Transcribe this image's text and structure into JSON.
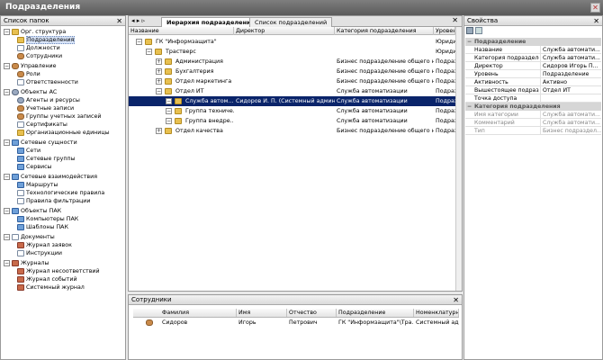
{
  "window": {
    "title": "Подразделения",
    "close_label": "✕"
  },
  "left": {
    "header": "Список папок",
    "tree": [
      {
        "label": "Орг. структура",
        "level": 0,
        "exp": "−",
        "icon": "org-structure-icon",
        "cls": "fold"
      },
      {
        "label": "Подразделения",
        "level": 1,
        "icon": "department-icon",
        "cls": "fold",
        "selected": true
      },
      {
        "label": "Должности",
        "level": 1,
        "icon": "position-icon",
        "cls": "doc"
      },
      {
        "label": "Сотрудники",
        "level": 1,
        "icon": "employee-icon",
        "cls": "person"
      },
      {
        "label": "Управление",
        "level": 0,
        "exp": "−",
        "icon": "management-icon",
        "cls": "person"
      },
      {
        "label": "Роли",
        "level": 1,
        "icon": "roles-icon",
        "cls": "person"
      },
      {
        "label": "Ответственности",
        "level": 1,
        "icon": "responsibility-icon",
        "cls": "doc"
      },
      {
        "label": "Объекты АС",
        "level": 0,
        "exp": "−",
        "icon": "as-objects-icon",
        "cls": "gear"
      },
      {
        "label": "Агенты и ресурсы",
        "level": 1,
        "icon": "agents-icon",
        "cls": "gear"
      },
      {
        "label": "Учетные записи",
        "level": 1,
        "icon": "accounts-icon",
        "cls": "person"
      },
      {
        "label": "Группы учетных записей",
        "level": 1,
        "icon": "account-groups-icon",
        "cls": "person"
      },
      {
        "label": "Сертификаты",
        "level": 1,
        "icon": "certificates-icon",
        "cls": "doc"
      },
      {
        "label": "Организационные единицы",
        "level": 1,
        "icon": "org-units-icon",
        "cls": "fold"
      },
      {
        "label": "Сетевые сущности",
        "level": 0,
        "exp": "−",
        "icon": "network-entities-icon",
        "cls": "net"
      },
      {
        "label": "Сети",
        "level": 1,
        "icon": "networks-icon",
        "cls": "net"
      },
      {
        "label": "Сетевые группы",
        "level": 1,
        "icon": "network-groups-icon",
        "cls": "net"
      },
      {
        "label": "Сервисы",
        "level": 1,
        "icon": "services-icon",
        "cls": "net"
      },
      {
        "label": "Сетевые взаимодействия",
        "level": 0,
        "exp": "−",
        "icon": "network-interactions-icon",
        "cls": "net"
      },
      {
        "label": "Маршруты",
        "level": 1,
        "icon": "routes-icon",
        "cls": "net"
      },
      {
        "label": "Технологические правила",
        "level": 1,
        "icon": "tech-rules-icon",
        "cls": "doc"
      },
      {
        "label": "Правила фильтрации",
        "level": 1,
        "icon": "filter-rules-icon",
        "cls": "doc"
      },
      {
        "label": "Объекты ПАК",
        "level": 0,
        "exp": "−",
        "icon": "pak-objects-icon",
        "cls": "net"
      },
      {
        "label": "Компьютеры ПАК",
        "level": 1,
        "icon": "pak-computers-icon",
        "cls": "net"
      },
      {
        "label": "Шаблоны ПАК",
        "level": 1,
        "icon": "pak-templates-icon",
        "cls": "net"
      },
      {
        "label": "Документы",
        "level": 0,
        "exp": "−",
        "icon": "documents-icon",
        "cls": "doc"
      },
      {
        "label": "Журнал заявок",
        "level": 1,
        "icon": "requests-journal-icon",
        "cls": "book"
      },
      {
        "label": "Инструкции",
        "level": 1,
        "icon": "instructions-icon",
        "cls": "doc"
      },
      {
        "label": "Журналы",
        "level": 0,
        "exp": "−",
        "icon": "journals-icon",
        "cls": "book"
      },
      {
        "label": "Журнал несоответствий",
        "level": 1,
        "icon": "mismatch-journal-icon",
        "cls": "book"
      },
      {
        "label": "Журнал событий",
        "level": 1,
        "icon": "events-journal-icon",
        "cls": "book"
      },
      {
        "label": "Системный журнал",
        "level": 1,
        "icon": "system-journal-icon",
        "cls": "book"
      }
    ]
  },
  "center": {
    "tabs": [
      "Иерархия подразделений",
      "Список подразделений"
    ],
    "columns": [
      "Название",
      "Директор",
      "Категория подразделения",
      "Уровень"
    ],
    "rows": [
      {
        "name": "ГК \"Информзащита\"",
        "director": "",
        "category": "",
        "level": "Юридиче",
        "indent": 0,
        "exp": "−"
      },
      {
        "name": "Трастверс",
        "director": "",
        "category": "",
        "level": "Юридиче",
        "indent": 1,
        "exp": "−"
      },
      {
        "name": "Администрация",
        "director": "",
        "category": "Бизнес подразделение общего наз...",
        "level": "Подразде",
        "indent": 2,
        "exp": "+"
      },
      {
        "name": "Бухгалтерия",
        "director": "",
        "category": "Бизнес подразделение общего наз...",
        "level": "Подразде",
        "indent": 2,
        "exp": "+"
      },
      {
        "name": "Отдел маркетинга",
        "director": "",
        "category": "Бизнес подразделение общего наз...",
        "level": "Подразде",
        "indent": 2,
        "exp": "+"
      },
      {
        "name": "Отдел ИТ",
        "director": "",
        "category": "Служба автоматизации",
        "level": "Подразде",
        "indent": 2,
        "exp": "−"
      },
      {
        "name": "Служба автом...",
        "director": "Сидоров И. П. (Системный админис...",
        "category": "Служба автоматизации",
        "level": "Подразде",
        "indent": 3,
        "exp": "−",
        "selected": true
      },
      {
        "name": "Группа техниче...",
        "director": "",
        "category": "Служба автоматизации",
        "level": "Подразде",
        "indent": 3,
        "exp": "−"
      },
      {
        "name": "Группа внедре...",
        "director": "",
        "category": "Служба автоматизации",
        "level": "Подразде",
        "indent": 3,
        "exp": "−"
      },
      {
        "name": "Отдел качества",
        "director": "",
        "category": "Бизнес подразделение общего наз...",
        "level": "Подразде",
        "indent": 2,
        "exp": "+"
      }
    ]
  },
  "employees": {
    "header": "Сотрудники",
    "columns": [
      "Фамилия",
      "Имя",
      "Отчество",
      "Подразделение",
      "Номенклатурн..."
    ],
    "rows": [
      {
        "last": "Сидоров",
        "first": "Игорь",
        "middle": "Петрович",
        "dept": "ГК \"Информзащита\"\\Тра...",
        "nomen": "Системный админ..."
      }
    ]
  },
  "properties": {
    "header": "Свойства",
    "cat1": "Подразделение",
    "rows1": [
      {
        "name": "Название",
        "value": "Служба автомати..."
      },
      {
        "name": "Категория подразделения",
        "value": "Служба автомати..."
      },
      {
        "name": "Директор",
        "value": "Сидоров Игорь П..."
      },
      {
        "name": "Уровень",
        "value": "Подразделение"
      },
      {
        "name": "Активность",
        "value": "Активно"
      },
      {
        "name": "Вышестоящее подраздел...",
        "value": "Отдел ИТ"
      },
      {
        "name": "Точка доступа",
        "value": ""
      }
    ],
    "cat2": "Категория подразделения",
    "rows2": [
      {
        "name": "Имя категории",
        "value": "Служба автомати..."
      },
      {
        "name": "Комментарий",
        "value": "Служба автомати..."
      },
      {
        "name": "Тип",
        "value": "Бизнес подраздел..."
      }
    ]
  },
  "colors": {
    "selection": "#0a246a",
    "title_bar": "#6a6a6a"
  }
}
